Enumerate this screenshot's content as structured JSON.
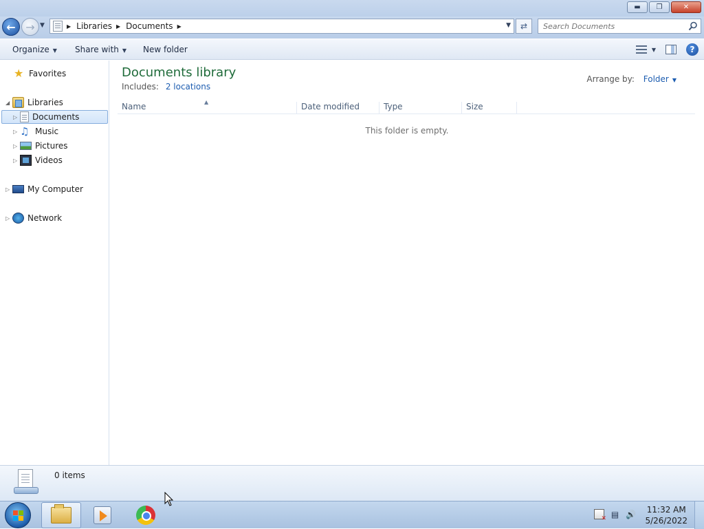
{
  "window": {
    "controls": {
      "minimize": "▬",
      "maximize": "❐",
      "close": "✕"
    }
  },
  "address": {
    "breadcrumbs": [
      "Libraries",
      "Documents"
    ],
    "search_placeholder": "Search Documents"
  },
  "toolbar": {
    "organize_label": "Organize",
    "share_label": "Share with",
    "new_folder_label": "New folder"
  },
  "navigation": {
    "favorites": "Favorites",
    "libraries": "Libraries",
    "library_items": [
      {
        "label": "Documents",
        "icon": "documents-icon",
        "selected": true
      },
      {
        "label": "Music",
        "icon": "music-icon",
        "selected": false
      },
      {
        "label": "Pictures",
        "icon": "pictures-icon",
        "selected": false
      },
      {
        "label": "Videos",
        "icon": "videos-icon",
        "selected": false
      }
    ],
    "computer": "My Computer",
    "network": "Network"
  },
  "content": {
    "title": "Documents library",
    "includes_label": "Includes:",
    "includes_link": "2 locations",
    "arrange_label": "Arrange by:",
    "arrange_value": "Folder",
    "columns": [
      "Name",
      "Date modified",
      "Type",
      "Size"
    ],
    "empty_message": "This folder is empty."
  },
  "details": {
    "item_count": "0 items"
  },
  "taskbar": {
    "pinned": [
      "windows-explorer-icon",
      "media-player-icon",
      "chrome-icon"
    ],
    "clock_time": "11:32 AM",
    "clock_date": "5/26/2022"
  },
  "colors": {
    "title_green": "#1f6b3a",
    "link_blue": "#1c5cb0",
    "selection_border": "#84acdd"
  }
}
